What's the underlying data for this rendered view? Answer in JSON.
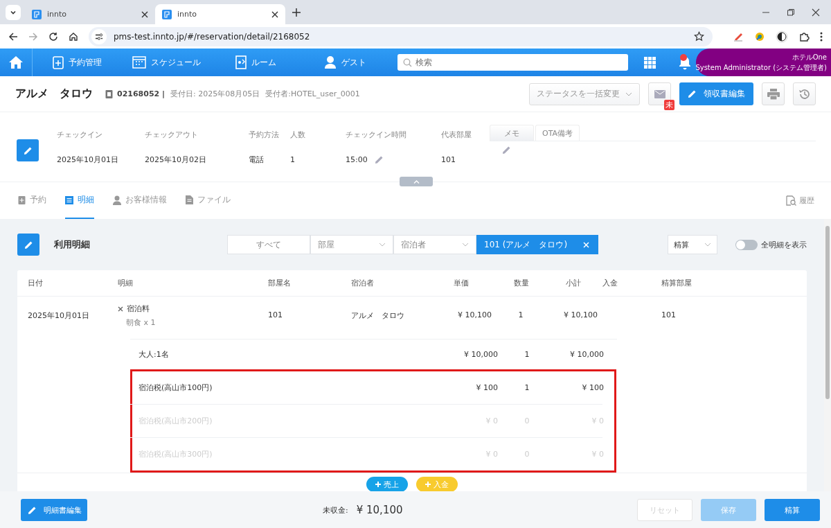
{
  "browser": {
    "tabs": [
      {
        "title": "innto",
        "selected": false
      },
      {
        "title": "innto",
        "selected": true
      }
    ],
    "url": "pms-test.innto.jp/#/reservation/detail/2168052"
  },
  "nav": {
    "items": [
      "予約管理",
      "スケジュール",
      "ルーム",
      "ゲスト"
    ],
    "search": {
      "placeholder": "検索"
    },
    "unread_notification": true,
    "hotel": "ホテルOne",
    "user": "System Administrator (システム管理者)"
  },
  "reservation": {
    "guest_name": "アルメ　タロウ",
    "number": "02168052 |",
    "received": "受付日: 2025年08月05日",
    "staff": "受付者:HOTEL_user_0001",
    "status_select": {
      "placeholder": "ステータスを一括変更"
    },
    "mail_badge": "未",
    "receipt_button": "領収書編集"
  },
  "summary": {
    "fields": [
      {
        "label": "チェックイン",
        "value": "2025年10月01日",
        "editable": false
      },
      {
        "label": "チェックアウト",
        "value": "2025年10月02日",
        "editable": false
      },
      {
        "label": "予約方法",
        "value": "電話",
        "editable": false
      },
      {
        "label": "人数",
        "value": "1",
        "editable": false
      },
      {
        "label": "チェックイン時間",
        "value": "15:00",
        "editable": true
      },
      {
        "label": "代表部屋",
        "value": "101",
        "editable": false
      }
    ],
    "memo_tabs": [
      {
        "label": "メモ",
        "selected": false
      },
      {
        "label": "OTA備考",
        "selected": true
      }
    ]
  },
  "detail_tabs": [
    {
      "label": "予約",
      "selected": false
    },
    {
      "label": "明細",
      "selected": true
    },
    {
      "label": "お客様情報",
      "selected": false
    },
    {
      "label": "ファイル",
      "selected": false
    }
  ],
  "history_link": "履歴",
  "statement": {
    "title": "利用明細",
    "filters": [
      {
        "kind": "all",
        "label": "すべて",
        "selected": false
      },
      {
        "kind": "dropdown",
        "label": "部屋",
        "selected": false
      },
      {
        "kind": "dropdown",
        "label": "宿泊者",
        "selected": false
      },
      {
        "kind": "chip",
        "label": "101 (アルメ　タロウ)",
        "selected": true
      }
    ],
    "mode_select": "精算",
    "show_all": {
      "label": "全明細を表示",
      "on": false
    },
    "columns": [
      "日付",
      "明細",
      "部屋名",
      "宿泊者",
      "単価",
      "数量",
      "小計",
      "入金",
      "精算部屋"
    ],
    "main_row": {
      "date": "2025年10月01日",
      "item": "宿泊料",
      "note": "朝食 x 1",
      "room": "101",
      "guest": "アルメ　タロウ",
      "unit_price": "¥ 10,100",
      "quantity": "1",
      "subtotal": "¥ 10,100",
      "settle_room": "101"
    },
    "sub_rows": [
      {
        "label": "大人:1名",
        "unit_price": "¥ 10,000",
        "quantity": "1",
        "subtotal": "¥ 10,000",
        "disabled": false
      }
    ],
    "tax_rows_highlighted": true,
    "tax_rows": [
      {
        "label": "宿泊税(高山市100円)",
        "unit_price": "¥ 100",
        "quantity": "1",
        "subtotal": "¥ 100",
        "disabled": false
      },
      {
        "label": "宿泊税(高山市200円)",
        "unit_price": "¥ 0",
        "quantity": "0",
        "subtotal": "¥ 0",
        "disabled": true
      },
      {
        "label": "宿泊税(高山市300円)",
        "unit_price": "¥ 0",
        "quantity": "0",
        "subtotal": "¥ 0",
        "disabled": true
      }
    ],
    "add_buttons": [
      {
        "kind": "sale",
        "label": "売上"
      },
      {
        "kind": "payment",
        "label": "入金"
      }
    ]
  },
  "footer": {
    "edit_button": "明細書編集",
    "balance_label": "未収金:",
    "balance": "¥ 10,100",
    "buttons": [
      {
        "kind": "reset",
        "label": "リセット",
        "disabled": true
      },
      {
        "kind": "save",
        "label": "保存",
        "disabled": true
      },
      {
        "kind": "settle",
        "label": "精算",
        "disabled": false
      }
    ]
  }
}
